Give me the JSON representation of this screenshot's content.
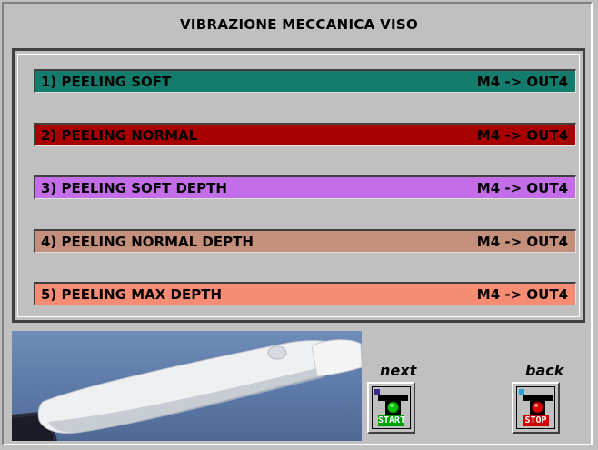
{
  "window": {
    "title": "VIBRAZIONE MECCANICA VISO"
  },
  "options": [
    {
      "label": "1)  PEELING  SOFT",
      "route": "M4 -> OUT4",
      "color": "#137c6c"
    },
    {
      "label": "2)  PEELING  NORMAL",
      "route": "M4 -> OUT4",
      "color": "#a80000"
    },
    {
      "label": "3)  PEELING SOFT DEPTH",
      "route": "M4 -> OUT4",
      "color": "#c36ee8"
    },
    {
      "label": "4)  PEELING  NORMAL DEPTH",
      "route": "M4 -> OUT4",
      "color": "#c4907c"
    },
    {
      "label": "5)  PEELING  MAX DEPTH",
      "route": "M4 -> OUT4",
      "color": "#f78c74"
    }
  ],
  "navigation": {
    "next_caption": "next",
    "back_caption": "back",
    "start_label": "START",
    "stop_label": "STOP",
    "start_light_color": "#00c000",
    "stop_light_color": "#e00000",
    "start_icon": "traffic-light-green-icon",
    "stop_icon": "traffic-light-red-icon"
  },
  "device_image": {
    "icon": "facial-vibration-handpiece-image"
  }
}
